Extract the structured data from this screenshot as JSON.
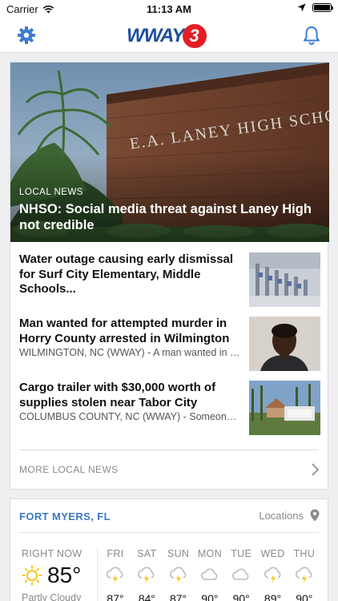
{
  "status_bar": {
    "carrier": "Carrier",
    "time": "11:13 AM"
  },
  "header": {
    "logo_text": "WWAY",
    "logo_number": "3"
  },
  "hero": {
    "category": "LOCAL NEWS",
    "headline": "NHSO: Social media threat against Laney High not credible",
    "sign_text": "E.A. LANEY HIGH SCHOOL"
  },
  "stories": [
    {
      "title": "Water outage causing early dismissal for Surf City Elementary, Middle Schools...",
      "desc": ""
    },
    {
      "title": "Man wanted for attempted murder in Horry County arrested in Wilmington",
      "desc": "WILMINGTON, NC (WWAY) - A man wanted in Horry County on attempted murder char..."
    },
    {
      "title": "Cargo trailer with $30,000 worth of supplies stolen near Tabor City",
      "desc": "COLUMBUS COUNTY, NC (WWAY) - Someone stole a cargo trailer with thousan..."
    }
  ],
  "more": {
    "label": "MORE LOCAL NEWS"
  },
  "weather": {
    "city": "FORT MYERS, FL",
    "locations_label": "Locations",
    "now": {
      "label": "RIGHT NOW",
      "temp": "85°",
      "condition": "Partly Cloudy",
      "icon": "sun-icon"
    },
    "forecast": [
      {
        "day": "FRI",
        "temp": "87°",
        "icon": "thunderstorm-icon"
      },
      {
        "day": "SAT",
        "temp": "84°",
        "icon": "thunderstorm-icon"
      },
      {
        "day": "SUN",
        "temp": "87°",
        "icon": "thunderstorm-icon"
      },
      {
        "day": "MON",
        "temp": "90°",
        "icon": "cloud-icon"
      },
      {
        "day": "TUE",
        "temp": "90°",
        "icon": "cloud-icon"
      },
      {
        "day": "WED",
        "temp": "89°",
        "icon": "thunderstorm-icon"
      },
      {
        "day": "THU",
        "temp": "90°",
        "icon": "thunderstorm-icon"
      }
    ]
  },
  "colors": {
    "brand_blue": "#1d4fa0",
    "brand_red": "#e41e26",
    "accent_blue": "#3a78c7",
    "icon_blue": "#3b7bd0",
    "sun_yellow": "#f5c518"
  }
}
